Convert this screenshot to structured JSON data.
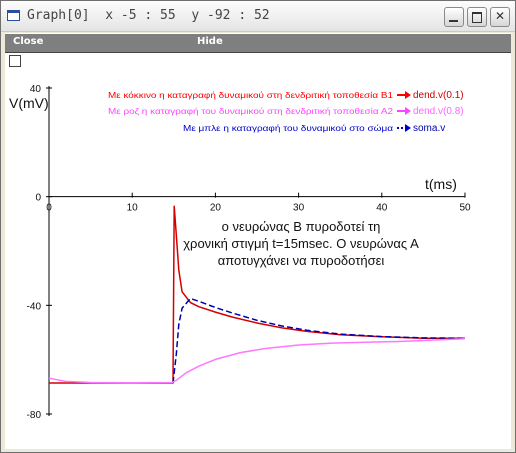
{
  "window": {
    "title": "Graph[0]  x -5 : 55  y -92 : 52",
    "menu": {
      "close_label": "Close",
      "hide_label": "Hide"
    }
  },
  "chart_data": {
    "type": "line",
    "xlabel": "t(ms)",
    "ylabel": "V(mV)",
    "xlim": [
      0,
      50
    ],
    "ylim": [
      -80,
      40
    ],
    "x_ticks": [
      0,
      10,
      20,
      30,
      40,
      50
    ],
    "y_ticks": [
      40,
      0,
      -40,
      -80
    ],
    "legend_placement": "top-right",
    "legend": [
      {
        "text": "Με κόκκινο η καταγραφή δυναμικού στη δενδριτική τοποθεσία Β1",
        "series": "dend.v(0.1)",
        "color": "#ff0000"
      },
      {
        "text": "Με ροζ η καταγραφή του δυναμικού στη δενδριτική τοποθεσία Α2",
        "series": "dend.v(0.8)",
        "color": "#ff66ff"
      },
      {
        "text": "Με μπλε η καταγραφή του δυναμικού στο σώμα",
        "series": "soma.v",
        "color": "#0000b0"
      }
    ],
    "annotation": "ο νευρώνας Β πυροδοτεί τη χρονική στιγμή t=15msec. Ο νευρώνας Α αποτυγχάνει να πυροδοτήσει",
    "series": [
      {
        "name": "dend.v(0.1)",
        "color": "#d40000",
        "dashed": false,
        "x": [
          0,
          10,
          14.9,
          15.05,
          15.2,
          15.6,
          16,
          17,
          18,
          20,
          22,
          25,
          28,
          31,
          35,
          40,
          45,
          50
        ],
        "y": [
          -68.6,
          -68.6,
          -68.6,
          -3.5,
          -10,
          -27,
          -35,
          -39,
          -40.5,
          -42.5,
          -44.3,
          -46.5,
          -48.3,
          -49.6,
          -50.8,
          -51.6,
          -52.1,
          -52.1
        ]
      },
      {
        "name": "soma.v",
        "color": "#0000b0",
        "dashed": true,
        "x": [
          14.9,
          15.3,
          15.6,
          16,
          17,
          18,
          20,
          22,
          25,
          28,
          31,
          35,
          40,
          45,
          50
        ],
        "y": [
          -68.6,
          -58,
          -47,
          -41,
          -37.5,
          -38.5,
          -40.8,
          -42.8,
          -45.5,
          -47.6,
          -49.2,
          -50.6,
          -51.5,
          -52,
          -52.1
        ]
      },
      {
        "name": "dend.v(0.8)",
        "color": "#ff77ff",
        "dashed": false,
        "x": [
          0,
          1,
          2,
          5,
          10,
          14.8,
          15.3,
          16.5,
          18,
          20,
          23,
          26,
          30,
          34,
          38,
          42,
          46,
          50
        ],
        "y": [
          -66.8,
          -67.4,
          -68,
          -68.4,
          -68.5,
          -68.4,
          -67.6,
          -64.8,
          -62.4,
          -59.9,
          -57.4,
          -55.9,
          -54.6,
          -53.9,
          -53.6,
          -53.3,
          -52.8,
          -52.3
        ]
      }
    ]
  }
}
